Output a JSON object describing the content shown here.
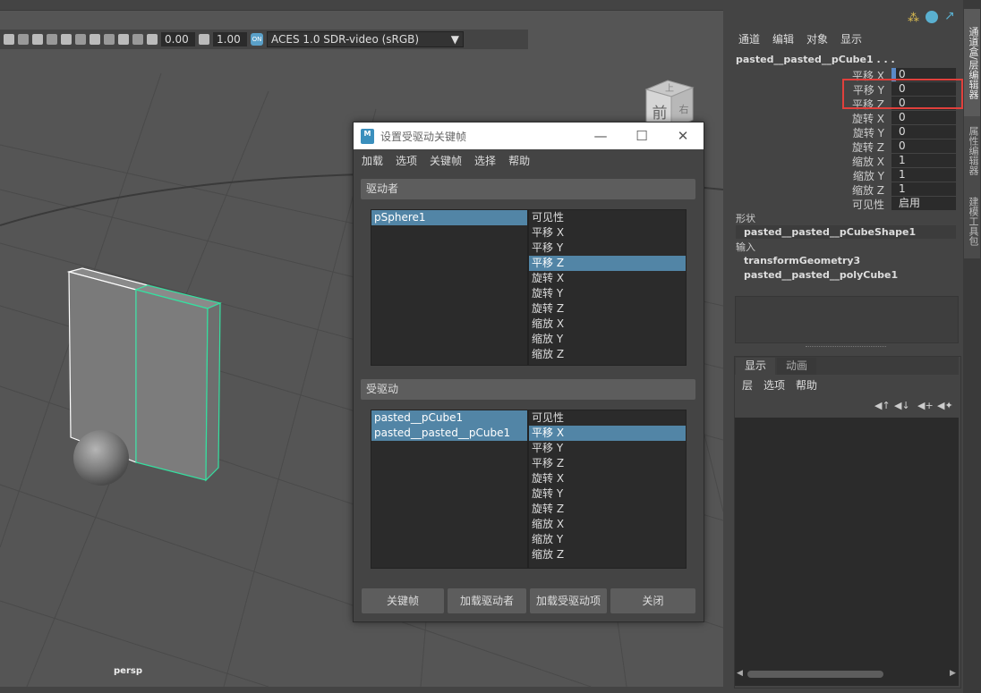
{
  "viewport": {
    "toolbar": {
      "exposure": "0.00",
      "gamma": "1.00",
      "cm_icon": "ON",
      "colorspace": "ACES 1.0 SDR-video (sRGB)"
    },
    "camera_label": "persp",
    "viewcube": {
      "top": "上",
      "front": "前",
      "right": "右"
    }
  },
  "dialog": {
    "title": "设置受驱动关键帧",
    "menu": [
      "加载",
      "选项",
      "关键帧",
      "选择",
      "帮助"
    ],
    "driver": {
      "header": "驱动者",
      "objects": [
        "pSphere1"
      ],
      "attributes": [
        "可见性",
        "平移 X",
        "平移 Y",
        "平移 Z",
        "旋转 X",
        "旋转 Y",
        "旋转 Z",
        "缩放 X",
        "缩放 Y",
        "缩放 Z"
      ],
      "selected_attribute": "平移 Z"
    },
    "driven": {
      "header": "受驱动",
      "objects": [
        "pasted__pCube1",
        "pasted__pasted__pCube1"
      ],
      "attributes": [
        "可见性",
        "平移 X",
        "平移 Y",
        "平移 Z",
        "旋转 X",
        "旋转 Y",
        "旋转 Z",
        "缩放 X",
        "缩放 Y",
        "缩放 Z"
      ],
      "selected_attribute": "平移 X"
    },
    "buttons": [
      "关键帧",
      "加载驱动者",
      "加载受驱动项",
      "关闭"
    ]
  },
  "channel_box": {
    "menu": [
      "通道",
      "编辑",
      "对象",
      "显示"
    ],
    "object_name": "pasted__pasted__pCube1 . . .",
    "channels": [
      {
        "label": "平移 X",
        "value": "0"
      },
      {
        "label": "平移 Y",
        "value": "0"
      },
      {
        "label": "平移 Z",
        "value": "0"
      },
      {
        "label": "旋转 X",
        "value": "0"
      },
      {
        "label": "旋转 Y",
        "value": "0"
      },
      {
        "label": "旋转 Z",
        "value": "0"
      },
      {
        "label": "缩放 X",
        "value": "1"
      },
      {
        "label": "缩放 Y",
        "value": "1"
      },
      {
        "label": "缩放 Z",
        "value": "1"
      },
      {
        "label": "可见性",
        "value": "启用"
      }
    ],
    "shapes_header": "形状",
    "shape_name": "pasted__pasted__pCubeShape1",
    "inputs_header": "输入",
    "inputs": [
      "transformGeometry3",
      "pasted__pasted__polyCube1"
    ]
  },
  "layer_editor": {
    "tabs": [
      "显示",
      "动画"
    ],
    "menu": [
      "层",
      "选项",
      "帮助"
    ]
  },
  "side_tabs": [
    "通道盒/层编辑器",
    "属性编辑器",
    "建模工具包"
  ],
  "colors": {
    "selection": "#5285a6",
    "highlight_box": "#e0403c",
    "wire_green": "#35e0a0"
  }
}
